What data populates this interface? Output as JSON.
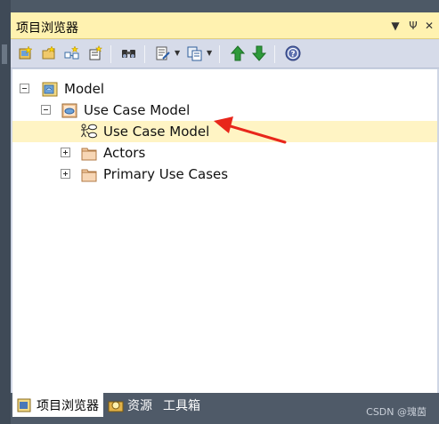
{
  "panel": {
    "title": "项目浏览器",
    "title_buttons": [
      "▼",
      "Ψ",
      "✕"
    ]
  },
  "toolbar": {
    "buttons": [
      "new-model-icon",
      "new-package-icon",
      "new-diagram-icon",
      "new-element-icon",
      "find-icon",
      "properties-icon",
      "copy-icon",
      "move-up-icon",
      "move-down-icon",
      "help-icon"
    ]
  },
  "tree": {
    "model": "Model",
    "use_case_package": "Use Case Model",
    "use_case_diagram": "Use Case Model",
    "actors": "Actors",
    "primary_use_cases": "Primary Use Cases"
  },
  "tabs": {
    "project_browser": "项目浏览器",
    "resources": "资源",
    "toolbox": "工具箱"
  },
  "watermark": "CSDN @瑰茵",
  "colors": {
    "title_bg": "#fff2b0",
    "selected_row": "#fff4c4",
    "arrow": "#e8261b",
    "tab_bar": "#4f5a68"
  }
}
